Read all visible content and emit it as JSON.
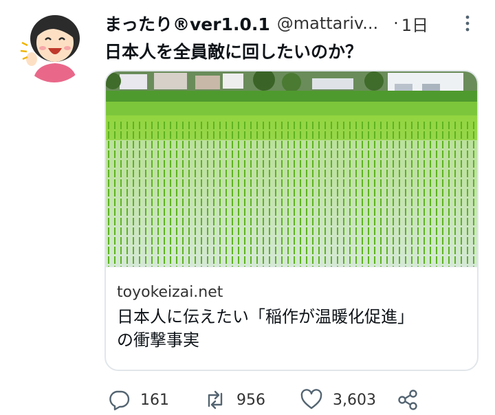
{
  "tweet": {
    "display_name": "まったり®ver1.0.1",
    "handle": "@mattariv...",
    "separator": "·",
    "time": "1日",
    "text": "日本人を全員敵に回したいのか？"
  },
  "card": {
    "domain": "toyokeizai.net",
    "title_line1": "日本人に伝えたい「稲作が温暖化促進」",
    "title_line2": "の衝撃事実"
  },
  "actions": {
    "reply_count": "161",
    "retweet_count": "956",
    "like_count": "3,603"
  },
  "icons": [
    "more-icon",
    "reply-icon",
    "retweet-icon",
    "like-icon",
    "share-icon"
  ],
  "colors": {
    "text": "#0f1419",
    "secondary": "#333333",
    "border": "#e1e6ea"
  }
}
